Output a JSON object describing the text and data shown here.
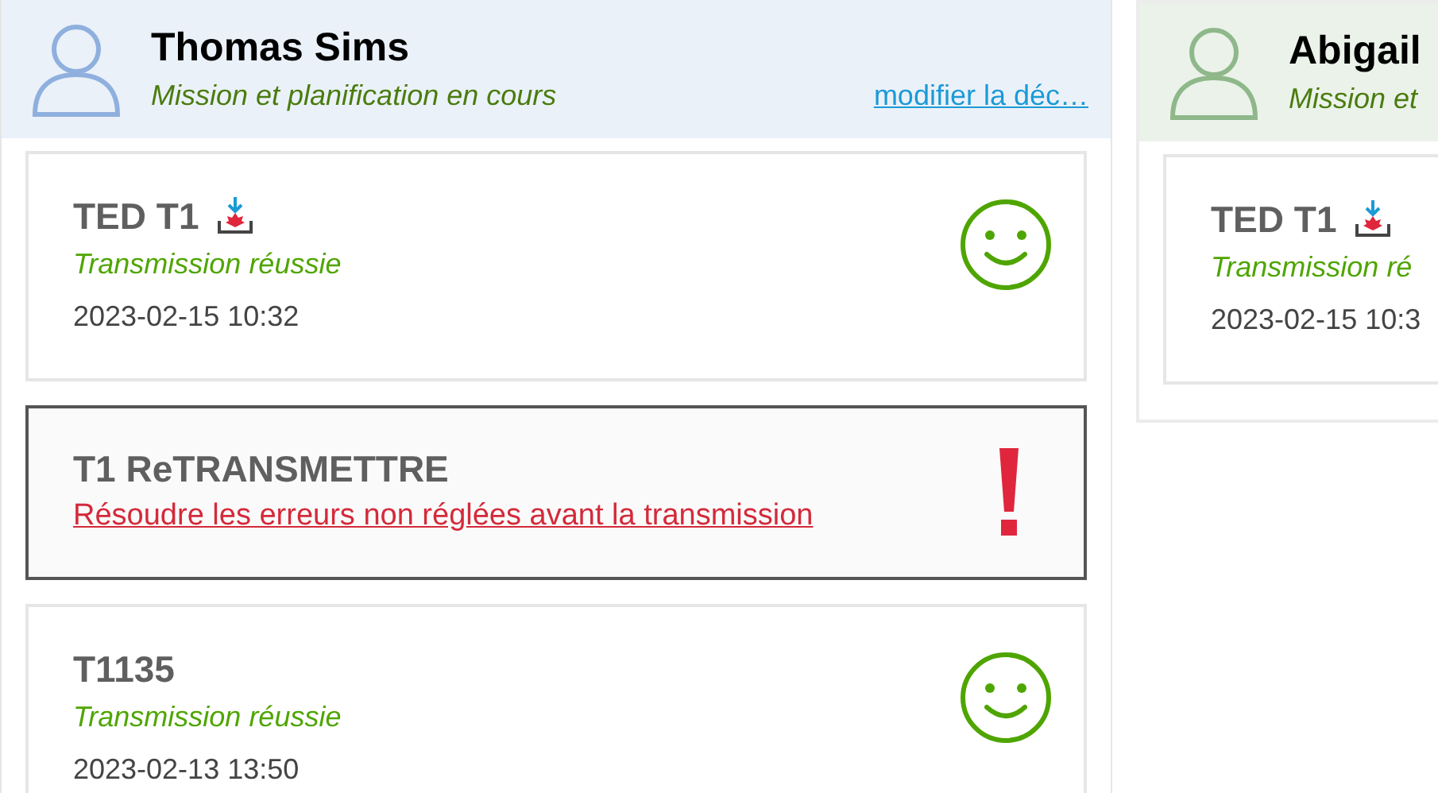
{
  "panels": [
    {
      "name": "Thomas Sims",
      "status": "Mission et planification en cours",
      "link": "modifier la déc…",
      "color": "#8fb0de",
      "cards": [
        {
          "kind": "success",
          "title": "TED T1",
          "download": true,
          "smiley": true,
          "status": "Transmission réussie",
          "date": "2023-02-15 10:32"
        },
        {
          "kind": "error",
          "title": "T1 ReTRANSMETTRE",
          "download": false,
          "status": "Résoudre les erreurs non réglées avant la transmission"
        },
        {
          "kind": "success",
          "title": "T1135",
          "download": false,
          "smiley": true,
          "status": "Transmission réussie",
          "date": "2023-02-13 13:50"
        }
      ]
    },
    {
      "name": "Abigail",
      "status": "Mission et",
      "color": "#8fb88a",
      "cards": [
        {
          "kind": "success",
          "title": "TED T1",
          "download": true,
          "status": "Transmission ré",
          "date": "2023-02-15 10:3"
        }
      ]
    }
  ]
}
